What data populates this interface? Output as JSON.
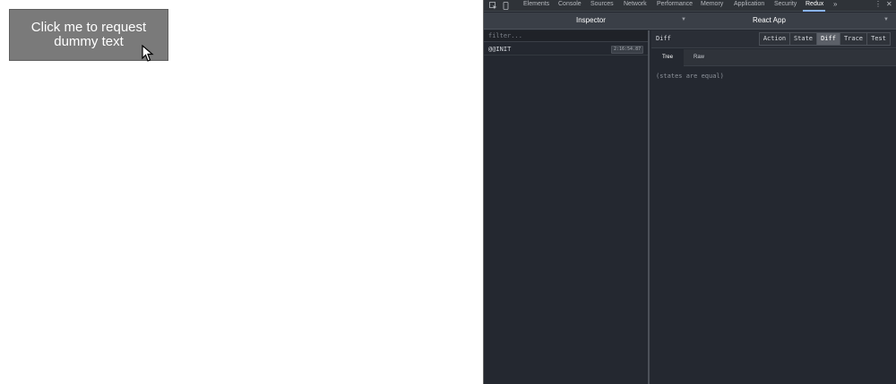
{
  "app": {
    "request_button_label": "Click me to request dummy text"
  },
  "devtools": {
    "tabs": [
      "Elements",
      "Console",
      "Sources",
      "Network",
      "Performance",
      "Memory",
      "Application",
      "Security",
      "Redux"
    ],
    "active_tab": "Redux",
    "more_tabs_glyph": "»",
    "menu_glyph": "⋮",
    "close_glyph": "✕",
    "redux": {
      "monitor_label": "Inspector",
      "instance_label": "React App",
      "filter_placeholder": "filter...",
      "actions": [
        {
          "name": "@@INIT",
          "time": "2:16:54.87"
        }
      ],
      "diff_title": "Diff",
      "modes": [
        "Action",
        "State",
        "Diff",
        "Trace",
        "Test"
      ],
      "active_mode": "Diff",
      "sub_tabs": [
        "Tree",
        "Raw"
      ],
      "active_sub_tab": "Tree",
      "diff_message": "(states are equal)"
    }
  },
  "colors": {
    "button_bg": "#7a7a7a",
    "devtools_bg": "#242830",
    "active_tab_underline": "#8ab4f8"
  }
}
